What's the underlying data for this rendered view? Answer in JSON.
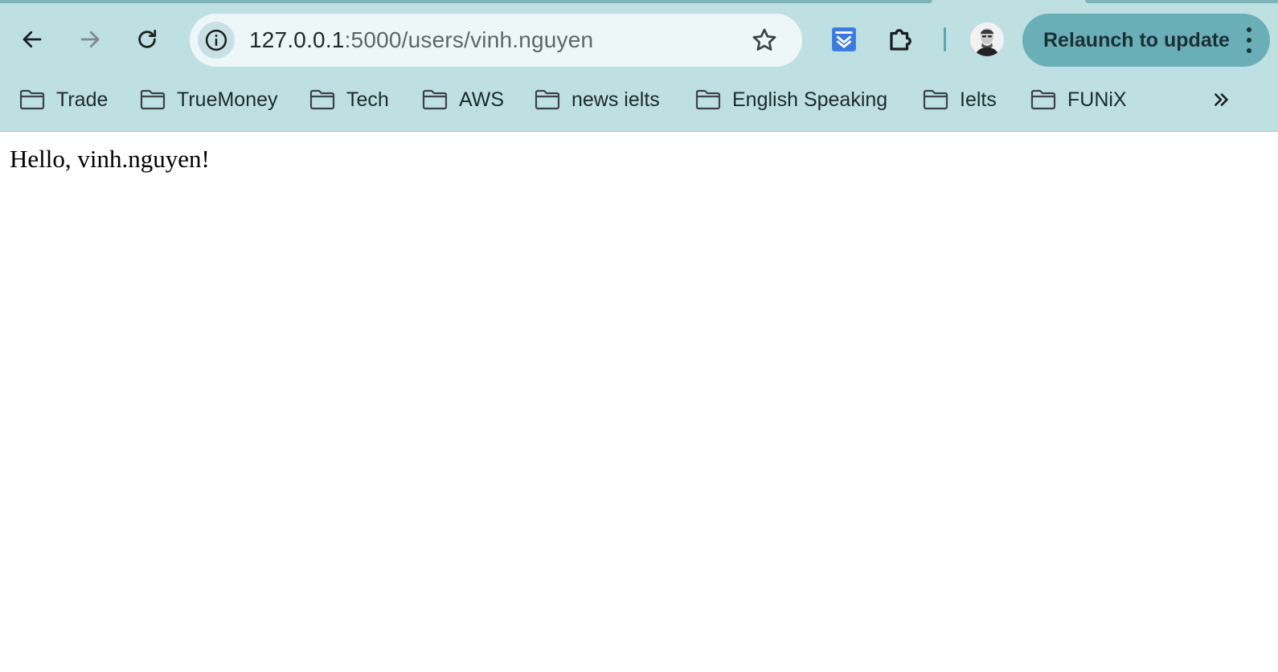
{
  "browser": {
    "toolbar": {
      "back_icon": "arrow-left-icon",
      "forward_icon": "arrow-right-icon",
      "reload_icon": "reload-icon"
    },
    "omnibox": {
      "host": "127.0.0.1",
      "path": ":5000/users/vinh.nguyen",
      "site_info_icon": "info-icon",
      "bookmark_star_icon": "star-icon"
    },
    "extensions": [
      "pocket-icon",
      "puzzle-icon"
    ],
    "relaunch_label": "Relaunch to update",
    "colors": {
      "chrome_bg": "#bfe0e3",
      "relaunch_bg": "#6aaeb8",
      "pocket_blue": "#3b7ae0"
    }
  },
  "bookmarks": {
    "items": [
      {
        "label": "Trade"
      },
      {
        "label": "TrueMoney"
      },
      {
        "label": "Tech"
      },
      {
        "label": "AWS"
      },
      {
        "label": "news ielts"
      },
      {
        "label": "English Speaking"
      },
      {
        "label": "Ielts"
      },
      {
        "label": "FUNiX"
      }
    ],
    "overflow_icon": "chevron-double-right-icon"
  },
  "page": {
    "greeting": "Hello, vinh.nguyen!"
  }
}
